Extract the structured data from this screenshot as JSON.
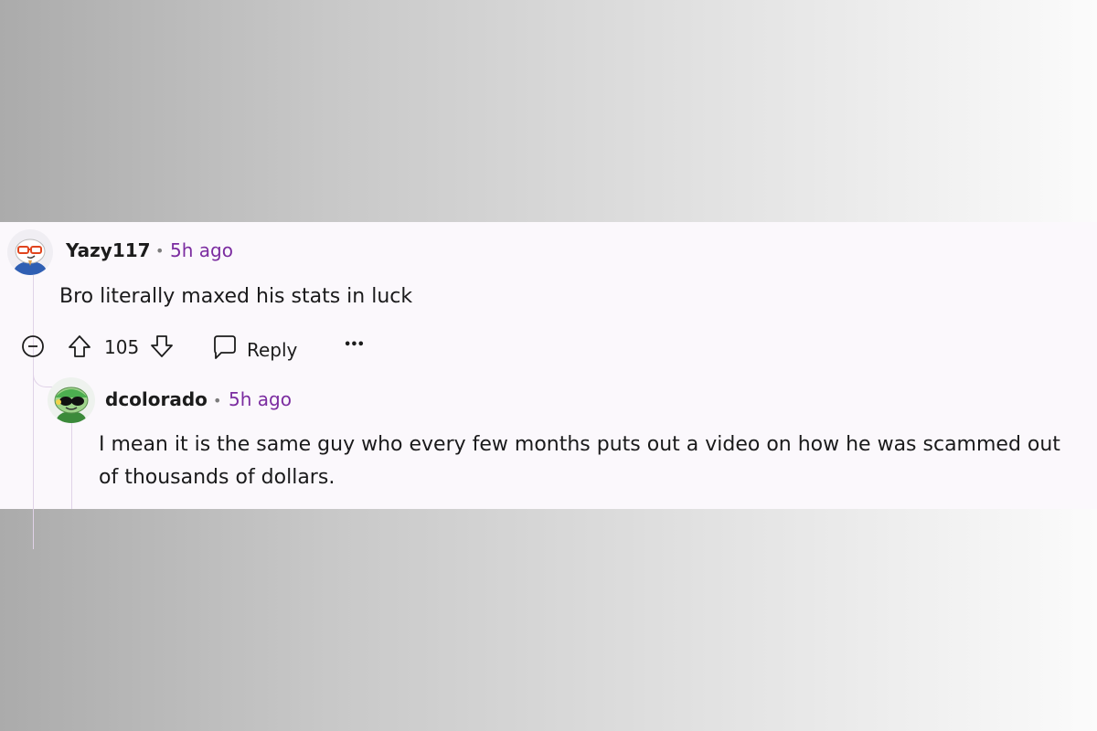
{
  "comments": [
    {
      "author": "Yazy117",
      "separator": "•",
      "time": "5h ago",
      "body": "Bro literally maxed his stats in luck",
      "votes": "105",
      "reply_label": "Reply",
      "more_label": "•••"
    },
    {
      "author": "dcolorado",
      "separator": "•",
      "time": "5h ago",
      "body": "I mean it is the same guy who every few months puts out a video on how he was scammed out of thousands of dollars."
    }
  ],
  "colors": {
    "accent": "#7b2ca0",
    "panel_bg": "#fbf8fc",
    "thread_line": "#e0d3e8"
  },
  "icons": [
    "collapse-icon",
    "upvote-icon",
    "downvote-icon",
    "comment-bubble-icon",
    "more-options-icon"
  ]
}
